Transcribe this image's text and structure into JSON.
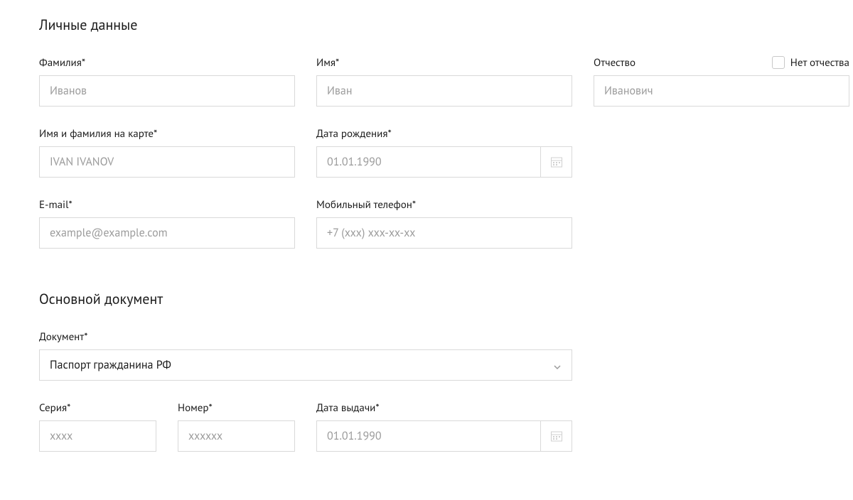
{
  "sections": {
    "personal": {
      "title": "Личные данные"
    },
    "document": {
      "title": "Основной документ"
    }
  },
  "fields": {
    "lastName": {
      "label": "Фамилия*",
      "placeholder": "Иванов"
    },
    "firstName": {
      "label": "Имя*",
      "placeholder": "Иван"
    },
    "patronymic": {
      "label": "Отчество",
      "placeholder": "Иванович"
    },
    "noPatronymic": {
      "label": "Нет отчества",
      "checked": false
    },
    "cardName": {
      "label": "Имя и фамилия на карте*",
      "placeholder": "IVAN IVANOV"
    },
    "birthDate": {
      "label": "Дата рождения*",
      "placeholder": "01.01.1990"
    },
    "email": {
      "label": "E-mail*",
      "placeholder": "example@example.com"
    },
    "phone": {
      "label": "Мобильный телефон*",
      "placeholder": "+7 (xxx) xxx-xx-xx"
    },
    "docType": {
      "label": "Документ*",
      "value": "Паспорт гражданина РФ"
    },
    "series": {
      "label": "Серия*",
      "placeholder": "xxxx"
    },
    "number": {
      "label": "Номер*",
      "placeholder": "xxxxxx"
    },
    "issueDate": {
      "label": "Дата выдачи*",
      "placeholder": "01.01.1990"
    }
  }
}
